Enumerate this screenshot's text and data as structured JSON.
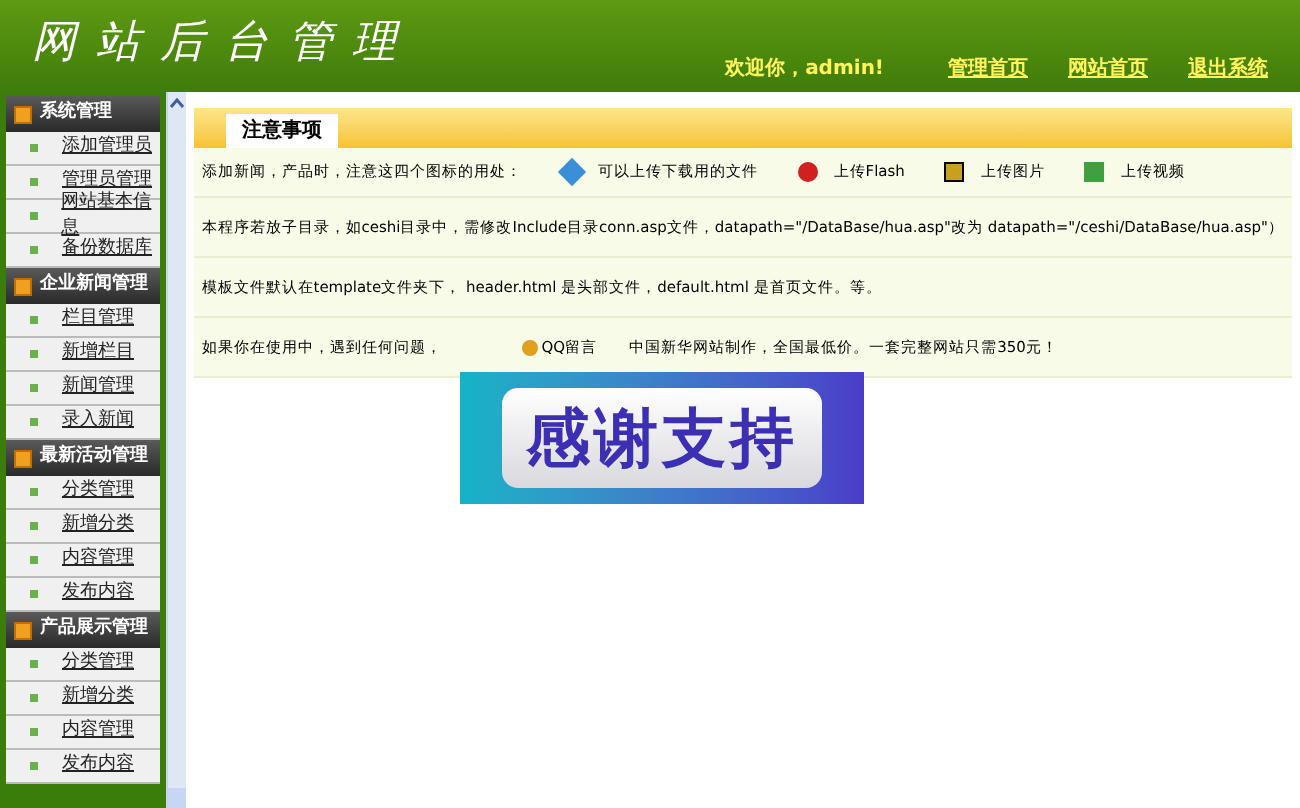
{
  "header": {
    "logo": "网站后台管理",
    "welcome": "欢迎你，admin!",
    "links": [
      "管理首页",
      "网站首页",
      "退出系统"
    ]
  },
  "sidebar": {
    "groups": [
      {
        "title": "系统管理",
        "items": [
          "添加管理员",
          "管理员管理",
          "网站基本信息",
          "备份数据库"
        ]
      },
      {
        "title": "企业新闻管理",
        "items": [
          "栏目管理",
          "新增栏目",
          "新闻管理",
          "录入新闻"
        ]
      },
      {
        "title": "最新活动管理",
        "items": [
          "分类管理",
          "新增分类",
          "内容管理",
          "发布内容"
        ]
      },
      {
        "title": "产品展示管理",
        "items": [
          "分类管理",
          "新增分类",
          "内容管理",
          "发布内容"
        ]
      }
    ]
  },
  "main": {
    "tab": "注意事项",
    "icon_row": {
      "intro": "添加新闻，产品时，注意这四个图标的用处：",
      "icons": [
        {
          "kind": "download",
          "label": "可以上传下载用的文件"
        },
        {
          "kind": "flash",
          "label": "上传Flash"
        },
        {
          "kind": "image",
          "label": "上传图片"
        },
        {
          "kind": "video",
          "label": "上传视频"
        }
      ]
    },
    "notes": [
      "本程序若放子目录，如ceshi目录中，需修改Include目录conn.asp文件，datapath=\"/DataBase/hua.asp\"改为 datapath=\"/ceshi/DataBase/hua.asp\"）",
      "模板文件默认在template文件夹下， header.html 是头部文件，default.html 是首页文件。等。"
    ],
    "contact": {
      "before": "如果你在使用中，遇到任何问题，",
      "qq": "QQ留言",
      "after": "中国新华网站制作，全国最低价。一套完整网站只需350元！"
    }
  },
  "banner": {
    "text": "感谢支持"
  }
}
